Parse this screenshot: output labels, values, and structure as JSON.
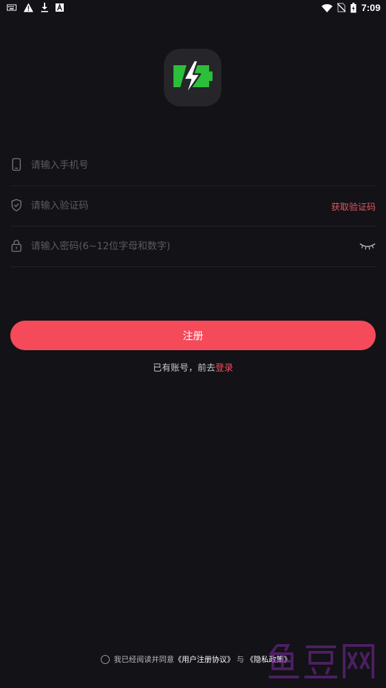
{
  "status_bar": {
    "time": "7:09",
    "icons": [
      "keyboard-icon",
      "warning-icon",
      "download-icon",
      "app-notification-icon",
      "wifi-icon",
      "no-sim-icon",
      "battery-icon"
    ]
  },
  "logo": {
    "icon": "battery-bolt-icon",
    "colors": {
      "background": "#25252a",
      "battery": "#2bbf3a",
      "bolt": "#ffffff"
    }
  },
  "form": {
    "phone": {
      "placeholder": "请输入手机号",
      "value": ""
    },
    "code": {
      "placeholder": "请输入验证码",
      "value": "",
      "get_code_label": "获取验证码"
    },
    "password": {
      "placeholder": "请输入密码(6~12位字母和数字)",
      "value": ""
    }
  },
  "register": {
    "label": "注册"
  },
  "login": {
    "prefix": "已有账号，前去",
    "link": "登录"
  },
  "agreement": {
    "prefix": "我已经阅读并同意",
    "user_agreement": "《用户注册协议》",
    "conjunction": "与",
    "privacy_policy": "《隐私政策》"
  },
  "colors": {
    "accent": "#f44a5a",
    "background": "#131217"
  }
}
